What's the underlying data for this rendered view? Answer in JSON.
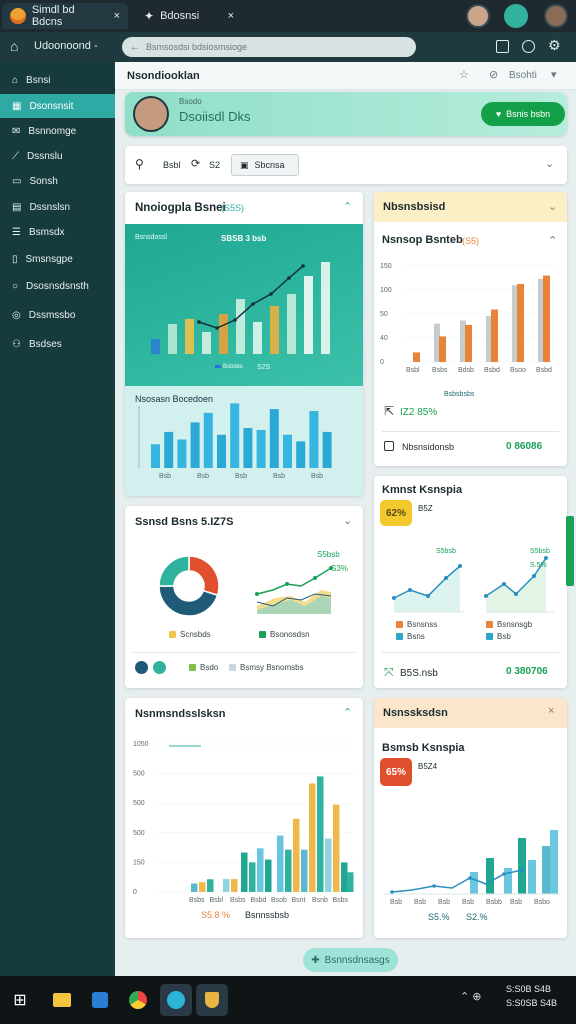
{
  "tabs": [
    {
      "label": "Simdl bd Bdcns",
      "close": "×"
    },
    {
      "label": "Bdosnsi",
      "close": "×"
    }
  ],
  "address": {
    "text": "Bsmsosdsi bdsiosmsioge",
    "back": "←",
    "home_label": "Udoonoond -"
  },
  "sidebar": {
    "items": [
      {
        "label": "Bsnsi",
        "icon": "home-icon"
      },
      {
        "label": "Dsonsnsit",
        "icon": "grid-icon"
      },
      {
        "label": "Bsnnomge",
        "icon": "mail-icon"
      },
      {
        "label": "Dssnslu",
        "icon": "chart-icon"
      },
      {
        "label": "Sonsh",
        "icon": "chat-icon"
      },
      {
        "label": "Dssnslsn",
        "icon": "calendar-icon"
      },
      {
        "label": "Bsmsdx",
        "icon": "list-icon"
      },
      {
        "label": "Smsnsgpe",
        "icon": "document-icon"
      },
      {
        "label": "Dsosnsdsnsth",
        "icon": "circle-icon"
      },
      {
        "label": "Dssmssbo",
        "icon": "settings-icon"
      },
      {
        "label": "Bsdses",
        "icon": "users-icon"
      }
    ]
  },
  "header": {
    "title": "Nsondiooklan",
    "action_label": "Bsohti"
  },
  "profile": {
    "subtitle": "Bsodo",
    "name": "Dsoiisdl Dks",
    "button": "Bsnis bsbn"
  },
  "filters": {
    "a": "Bsbl",
    "b": "S2",
    "button": "Sbcnsa"
  },
  "card_a": {
    "title": "Nnoiogpla Bsnei",
    "badge": "(S5S)",
    "top_label": "Bsnsdossl",
    "top_value": "SBSB 3 bsb",
    "top_legend": "Bsbsbs",
    "top_value2": "S2S",
    "bottom_label": "Nsosasn Bocedoen"
  },
  "card_b": {
    "header": "Nbsnsbsisd",
    "title": "Nsnsop Bsnteb",
    "badge": "(S5)",
    "ticks": [
      "150",
      "100",
      "50",
      "40",
      "0"
    ],
    "x": [
      "Bsbl",
      "Bsbs",
      "Bdsb",
      "Bsbd",
      "Bsoo",
      "Bsbd"
    ],
    "legend": "Bsbsbsbs",
    "stat_a": "IZ2 85%",
    "foot_label": "Nbsnsidonsb",
    "foot_value": "0 86086"
  },
  "card_c": {
    "title": "Ssnsd Bsns 5.IZ7S",
    "legend_a": "Scnsbds",
    "legend_b": "Bsonosdsn",
    "badge": "S5bsb",
    "badge2": "S3%",
    "foot_a": "Bsdo",
    "foot_b": "Bsmsy Bsnomsbs"
  },
  "card_d": {
    "title": "Kmnst Ksnspia",
    "pct": "62%",
    "sub": "B5Z",
    "badge_l": "S5bsb",
    "badge_r": "S5bsb",
    "pct_l": "S.5%",
    "pct_r": "S.5%",
    "leg_l1": "Bsnsnss",
    "leg_l2": "Bsns",
    "leg_r1": "Bsnsnsgb",
    "leg_r2": "Bsb",
    "foot_l": "B5S.nsb",
    "foot_r": "0 380706"
  },
  "card_e": {
    "title": "Nsnmsndsslsksn",
    "ticks": [
      "1050",
      "500",
      "500",
      "500",
      "150",
      "0"
    ],
    "x": [
      "Bsbs",
      "Bsbl",
      "Bsbs",
      "Bsbd",
      "Bsob",
      "Bsnt",
      "Bsnb",
      "Bsbs"
    ],
    "pct": "S5.8 %",
    "label": "Bsnnssbsb"
  },
  "card_f": {
    "header": "Nsnssksdsn",
    "title": "Bsmsb Ksnspia",
    "pct": "65%",
    "sub": "B5Z4",
    "x": [
      "Bsb",
      "Bsb",
      "Bsb",
      "Bsb",
      "Bsbb",
      "Bsb",
      "Bsbo"
    ],
    "pct_l": "S5.%",
    "pct_r": "S2.%"
  },
  "bottom_button": "Bsnnsdnsasgs",
  "taskbar": {
    "time": "S:S0B S4B",
    "date": "S:S0SB S4B"
  },
  "colors": {
    "teal": "#2fb39e",
    "orange": "#e9833a",
    "green": "#1aa156",
    "navy": "#1f5a78",
    "sidebar": "#173a3c"
  },
  "chart_data": [
    {
      "type": "bar",
      "title": "Nnoiogpla Bsnei",
      "values_a": [
        15,
        30,
        35,
        22,
        40,
        55,
        32,
        48,
        60,
        78,
        92
      ],
      "values_b": [
        25,
        38,
        30,
        48,
        58,
        35,
        68,
        42,
        40,
        62,
        35,
        28,
        60,
        38
      ]
    },
    {
      "type": "bar",
      "title": "Nsnsop Bsnteb",
      "categories": [
        "Bsbl",
        "Bsbs",
        "Bdsb",
        "Bsbd",
        "Bsoo",
        "Bsbd"
      ],
      "series": [
        {
          "name": "grey",
          "values": [
            0,
            60,
            65,
            72,
            120,
            130
          ]
        },
        {
          "name": "orange",
          "values": [
            15,
            40,
            58,
            82,
            122,
            135
          ]
        }
      ],
      "ylim": [
        0,
        150
      ]
    },
    {
      "type": "pie",
      "title": "Ssnsd Bsns 5.IZ7S",
      "values": [
        30,
        45,
        25
      ]
    },
    {
      "type": "bar",
      "title": "Nsnmsndsslsksn",
      "categories": [
        "Bsbs",
        "Bsbl",
        "Bsbs",
        "Bsbd",
        "Bsob",
        "Bsnt",
        "Bsnb",
        "Bsbs"
      ],
      "values": [
        150,
        210,
        250,
        120,
        430,
        470,
        300,
        690,
        830,
        1000,
        730,
        240
      ]
    }
  ]
}
